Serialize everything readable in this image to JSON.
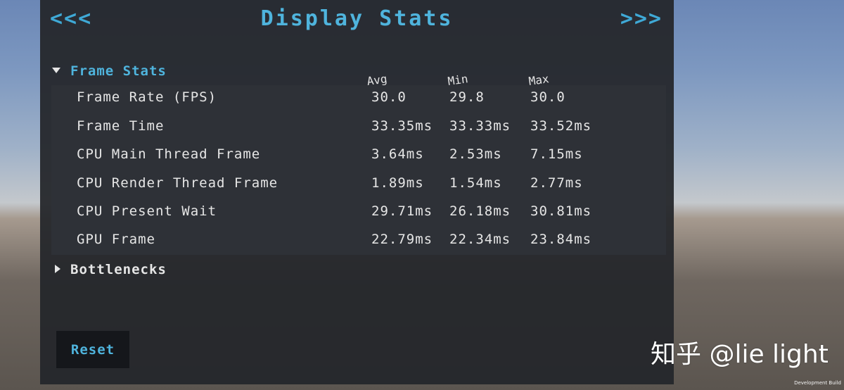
{
  "header": {
    "prev_label": "<<<",
    "title": "Display Stats",
    "next_label": ">>>"
  },
  "frame_stats": {
    "label": "Frame Stats",
    "expanded": true,
    "columns": [
      "Avg",
      "Min",
      "Max"
    ],
    "rows": [
      {
        "label": "Frame Rate (FPS)",
        "avg": "30.0",
        "min": "29.8",
        "max": "30.0"
      },
      {
        "label": "Frame Time",
        "avg": "33.35ms",
        "min": "33.33ms",
        "max": "33.52ms"
      },
      {
        "label": "CPU Main Thread Frame",
        "avg": "3.64ms",
        "min": "2.53ms",
        "max": "7.15ms"
      },
      {
        "label": "CPU Render Thread Frame",
        "avg": "1.89ms",
        "min": "1.54ms",
        "max": "2.77ms"
      },
      {
        "label": "CPU Present Wait",
        "avg": "29.71ms",
        "min": "26.18ms",
        "max": "30.81ms"
      },
      {
        "label": "GPU Frame",
        "avg": "22.79ms",
        "min": "22.34ms",
        "max": "23.84ms"
      }
    ]
  },
  "bottlenecks": {
    "label": "Bottlenecks",
    "expanded": false
  },
  "reset_label": "Reset",
  "watermark": "知乎 @lie light",
  "dev_build": "Development Build",
  "colors": {
    "accent": "#4fb4dd",
    "panel": "#24262b",
    "text": "#e6e6e6"
  }
}
